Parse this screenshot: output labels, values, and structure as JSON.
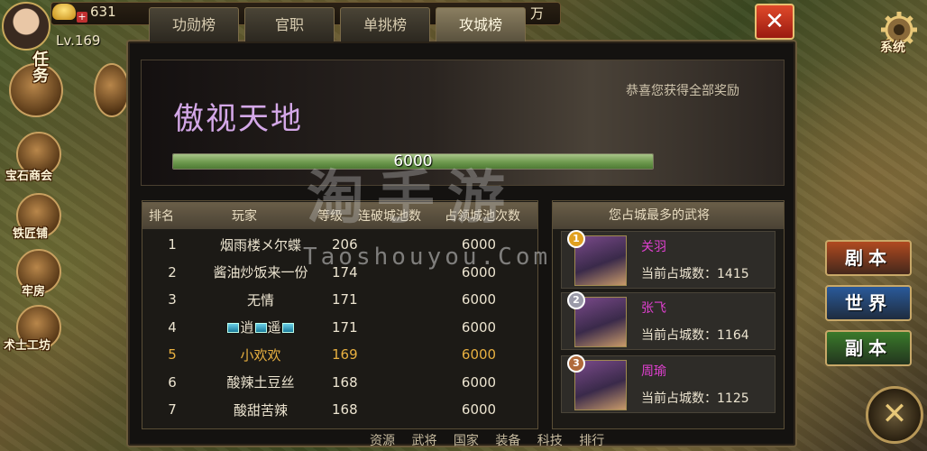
{
  "player": {
    "level": "Lv.169",
    "gold": "631",
    "resource_suffix": "万"
  },
  "side_menu": [
    "任务",
    "宝石商会",
    "铁匠铺",
    "牢房",
    "术士工坊"
  ],
  "tabs": [
    {
      "label": "功勋榜",
      "active": false
    },
    {
      "label": "官职",
      "active": false
    },
    {
      "label": "单挑榜",
      "active": false
    },
    {
      "label": "攻城榜",
      "active": true
    }
  ],
  "system_label": "系统",
  "banner": {
    "title": "傲视天地",
    "message": "恭喜您获得全部奖励",
    "progress_value": "6000",
    "progress_fraction": 1.0
  },
  "ranking": {
    "headers": [
      "排名",
      "玩家",
      "等级",
      "连破城池数",
      "占领城池次数"
    ],
    "rows": [
      {
        "rank": "1",
        "name": "烟雨楼メ尔蝶",
        "level": "206",
        "breaks": "",
        "occupied": "6000",
        "highlight": false
      },
      {
        "rank": "2",
        "name": "酱油炒饭来一份",
        "level": "174",
        "breaks": "",
        "occupied": "6000",
        "highlight": false
      },
      {
        "rank": "3",
        "name": "无情",
        "level": "171",
        "breaks": "",
        "occupied": "6000",
        "highlight": false
      },
      {
        "rank": "4",
        "name": "逍遥",
        "level": "171",
        "breaks": "",
        "occupied": "6000",
        "highlight": false
      },
      {
        "rank": "5",
        "name": "小欢欢",
        "level": "169",
        "breaks": "",
        "occupied": "6000",
        "highlight": true
      },
      {
        "rank": "6",
        "name": "酸辣土豆丝",
        "level": "168",
        "breaks": "",
        "occupied": "6000",
        "highlight": false
      },
      {
        "rank": "7",
        "name": "酸甜苦辣",
        "level": "168",
        "breaks": "",
        "occupied": "6000",
        "highlight": false
      }
    ]
  },
  "generals": {
    "header": "您占城最多的武将",
    "count_label": "当前占城数：",
    "items": [
      {
        "medal": "1",
        "medal_color": "#e0a020",
        "name": "关羽",
        "count": "1415"
      },
      {
        "medal": "2",
        "medal_color": "#9a9aa8",
        "name": "张飞",
        "count": "1164"
      },
      {
        "medal": "3",
        "medal_color": "#b06a3a",
        "name": "周瑜",
        "count": "1125"
      }
    ]
  },
  "right_buttons": [
    {
      "label": "剧本",
      "color": "#b04a20"
    },
    {
      "label": "世界",
      "color": "#2a5a9a"
    },
    {
      "label": "副本",
      "color": "#3a7a2a"
    }
  ],
  "bottom_nav": "资源 武将 国家 装备 科技 排行",
  "watermark": {
    "main": "淘手游",
    "sub": "Taoshouyou.Com"
  }
}
